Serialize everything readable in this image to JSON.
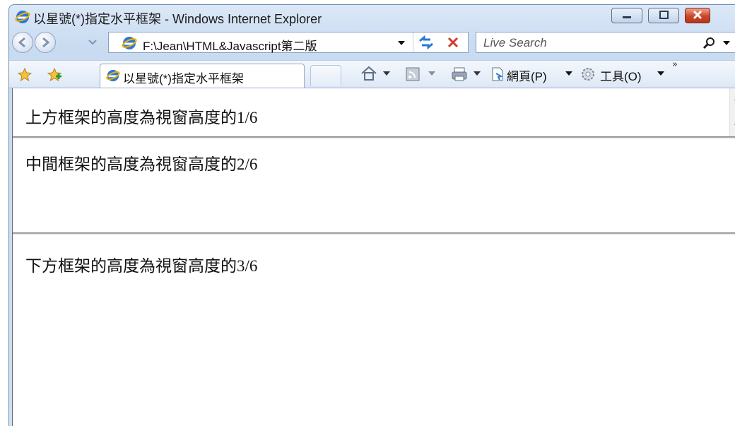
{
  "window": {
    "title": "以星號(*)指定水平框架 - Windows Internet Explorer"
  },
  "navigation": {
    "address": "F:\\Jean\\HTML&Javascript第二版",
    "search_placeholder": "Live Search"
  },
  "tabs": {
    "active_label": "以星號(*)指定水平框架"
  },
  "commandbar": {
    "page_label": "網頁(P)",
    "tools_label": "工具(O)"
  },
  "frames": {
    "top_text": "上方框架的高度為視窗高度的1/6",
    "middle_text": "中間框架的高度為視窗高度的2/6",
    "bottom_text": "下方框架的高度為視窗高度的3/6"
  },
  "colors": {
    "accent": "#1f6fd1",
    "close_red": "#c9462a"
  }
}
